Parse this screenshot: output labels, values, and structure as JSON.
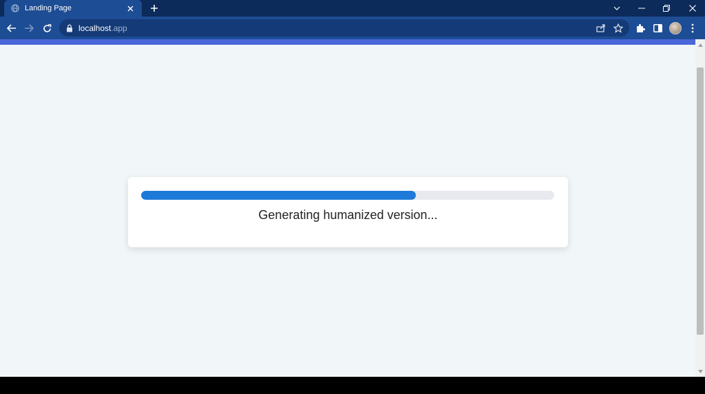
{
  "browser": {
    "tab": {
      "title": "Landing Page",
      "favicon": "globe-icon"
    },
    "address": {
      "host": "localhost",
      "tld": ".app"
    },
    "colors": {
      "tab_strip": "#0c2a5a",
      "toolbar": "#1d4d94",
      "accent_strip": "#4a67d9"
    }
  },
  "page": {
    "status_text": "Generating humanized version...",
    "progress": {
      "value_percent": 66.5,
      "color": "#1e7ad8",
      "track_color": "#e8e9ee"
    },
    "background": "#f1f7f9"
  }
}
